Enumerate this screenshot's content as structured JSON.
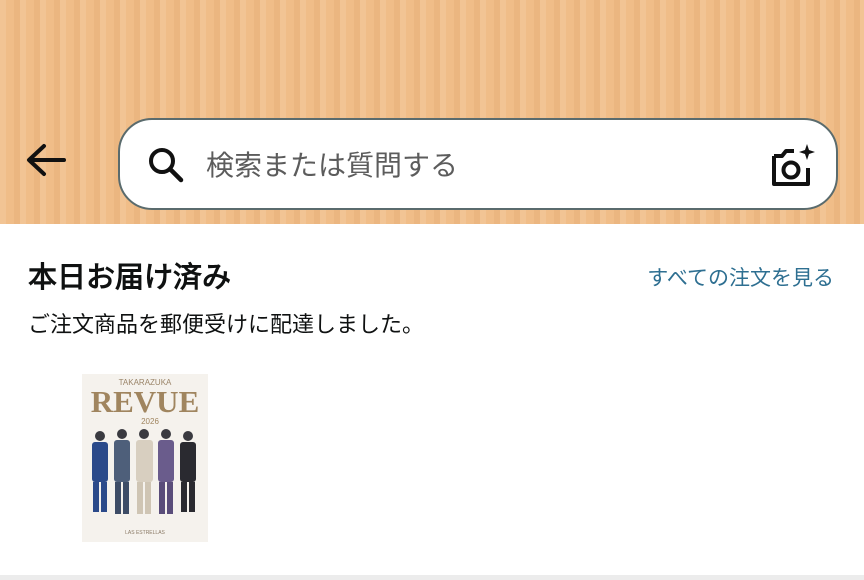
{
  "header": {
    "search": {
      "placeholder": "検索または質問する"
    }
  },
  "delivery": {
    "title": "本日お届け済み",
    "view_all_orders": "すべての注文を見る",
    "message": "ご注文商品を郵便受けに配達しました。"
  },
  "product": {
    "cover_small_top": "TAKARAZUKA",
    "cover_title": "REVUE",
    "cover_year": "2026",
    "cover_footer": "LAS ESTRELLAS"
  },
  "colors": {
    "header_bg": "#f0bd88",
    "link": "#2e6f91",
    "text": "#0f1111"
  }
}
